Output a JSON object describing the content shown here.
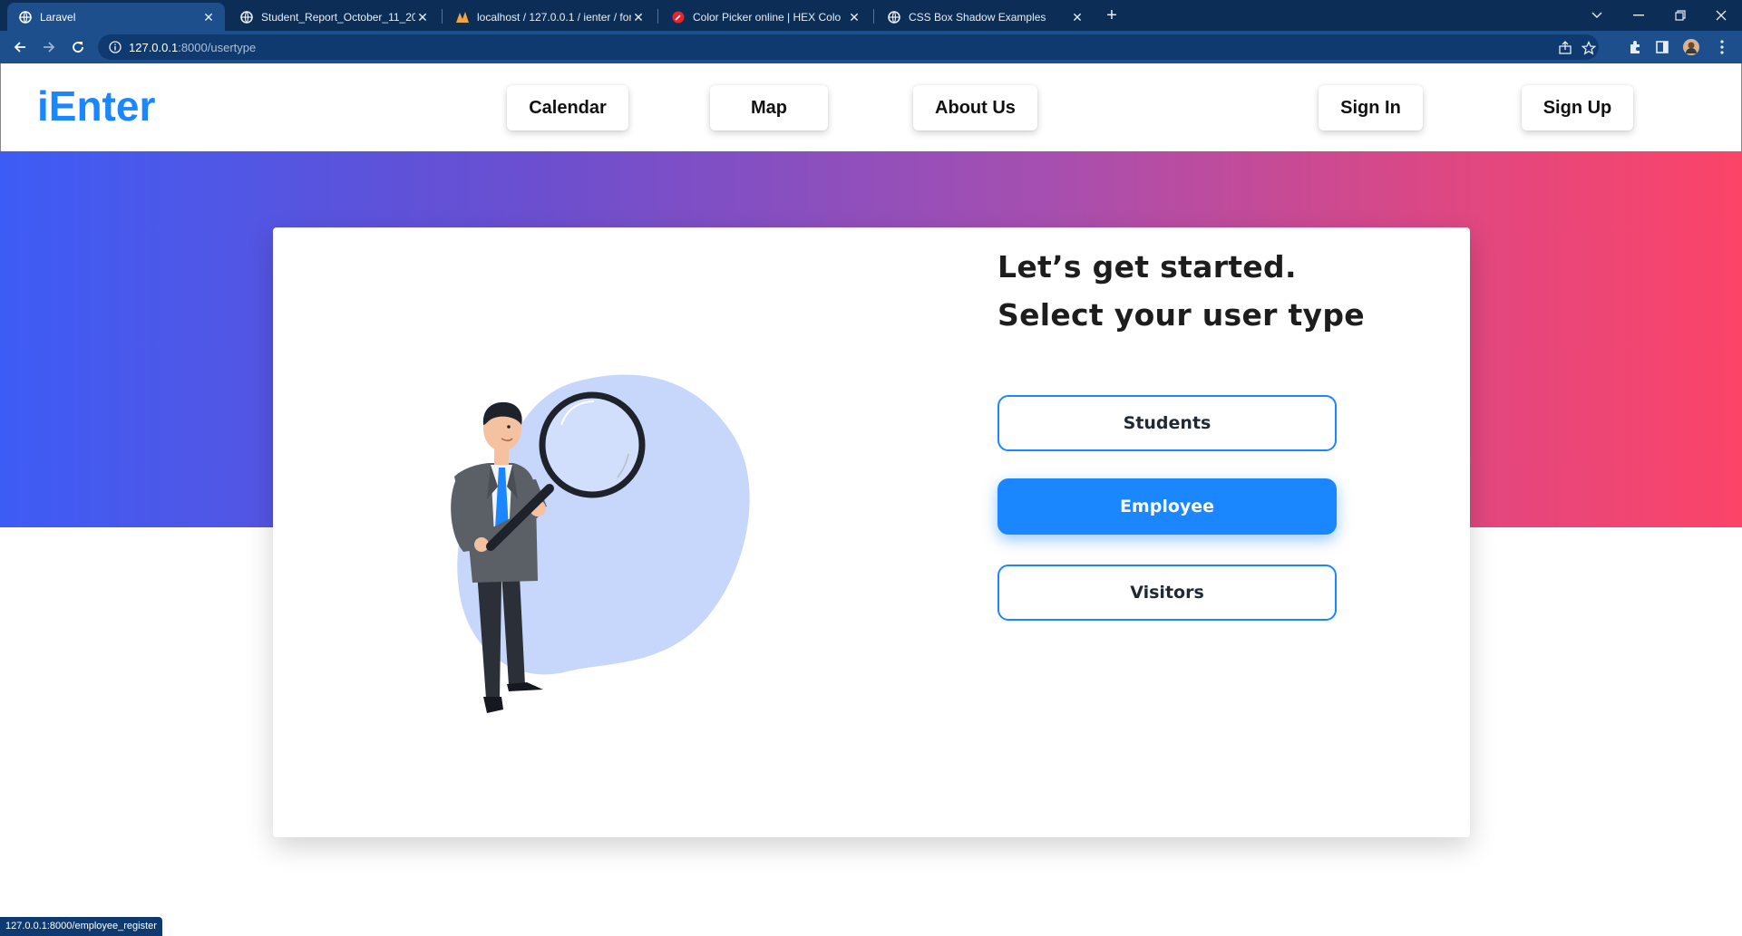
{
  "browser": {
    "tabs": [
      {
        "title": "Laravel",
        "active": true
      },
      {
        "title": "Student_Report_October_11_202",
        "active": false
      },
      {
        "title": "localhost / 127.0.0.1 / ienter / for",
        "active": false
      },
      {
        "title": "Color Picker online | HEX Colo",
        "active": false
      },
      {
        "title": "CSS Box Shadow Examples",
        "active": false
      }
    ],
    "url_host": "127.0.0.1",
    "url_path": ":8000/usertype",
    "status_url": "127.0.0.1:8000/employee_register"
  },
  "site": {
    "logo": "iEnter",
    "nav": {
      "calendar": "Calendar",
      "map": "Map",
      "about": "About Us",
      "signin": "Sign In",
      "signup": "Sign Up"
    }
  },
  "main": {
    "headline_1": "Let’s get started.",
    "headline_2": "Select your user type",
    "choices": {
      "students": "Students",
      "employee": "Employee",
      "visitors": "Visitors"
    },
    "selected_choice": "Employee"
  },
  "colors": {
    "brand": "#1a86ff",
    "tabbar": "#0c2d56",
    "toolbar": "#1d4f8c",
    "hero_start": "#3d5cf5",
    "hero_end": "#fb4468",
    "blob": "#c7d7fb"
  }
}
